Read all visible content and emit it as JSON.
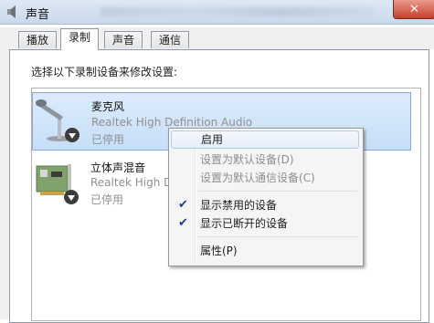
{
  "window": {
    "title": "声音"
  },
  "tabs": [
    {
      "label": "播放"
    },
    {
      "label": "录制"
    },
    {
      "label": "声音"
    },
    {
      "label": "通信"
    }
  ],
  "instructions": "选择以下录制设备来修改设置:",
  "devices": [
    {
      "name": "麦克风",
      "description": "Realtek High Definition Audio",
      "status": "已停用",
      "icon": "microphone-icon"
    },
    {
      "name": "立体声混音",
      "description": "Realtek High Definition Audio",
      "status": "已停用",
      "icon": "sound-card-icon"
    }
  ],
  "context_menu": {
    "items": [
      {
        "label": "启用",
        "enabled": true,
        "checked": false
      },
      {
        "label": "设置为默认设备(D)",
        "enabled": false,
        "checked": false
      },
      {
        "label": "设置为默认通信设备(C)",
        "enabled": false,
        "checked": false
      },
      {
        "label": "显示禁用的设备",
        "enabled": true,
        "checked": true
      },
      {
        "label": "显示已断开的设备",
        "enabled": true,
        "checked": true
      },
      {
        "label": "属性(P)",
        "enabled": true,
        "checked": false
      }
    ]
  },
  "colors": {
    "selection": "#c6dff8",
    "check": "#1f3e8c",
    "close_button": "#c4412b"
  }
}
